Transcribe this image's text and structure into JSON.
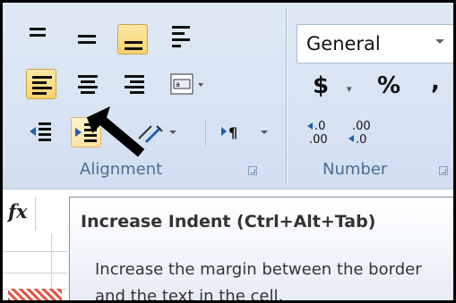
{
  "ribbon": {
    "alignment": {
      "group_label": "Alignment",
      "launcher_icon": "dialog-launcher-icon",
      "buttons": [
        {
          "name": "top-align",
          "icon": "align-top-icon"
        },
        {
          "name": "middle-align",
          "icon": "align-middle-icon"
        },
        {
          "name": "bottom-align",
          "icon": "align-bottom-icon",
          "state": "active"
        },
        {
          "name": "wrap-text",
          "icon": "wrap-text-icon"
        },
        {
          "name": "align-left",
          "icon": "align-text-left-icon",
          "state": "active"
        },
        {
          "name": "center",
          "icon": "align-text-center-icon"
        },
        {
          "name": "align-right",
          "icon": "align-text-right-icon"
        },
        {
          "name": "merge-center",
          "icon": "merge-center-icon"
        },
        {
          "name": "decrease-indent",
          "icon": "decrease-indent-icon"
        },
        {
          "name": "increase-indent",
          "icon": "increase-indent-icon",
          "state": "hover"
        },
        {
          "name": "orientation",
          "icon": "orientation-icon"
        },
        {
          "name": "text-direction",
          "icon": "text-direction-icon"
        }
      ]
    },
    "number": {
      "group_label": "Number",
      "format_value": "General",
      "currency_symbol": "$",
      "percent_symbol": "%",
      "comma_symbol": ",",
      "increase_decimal": ".0\n.00",
      "decrease_decimal": ".00\n.0"
    }
  },
  "formula_bar": {
    "fx_label": "fx"
  },
  "tooltip": {
    "title": "Increase Indent (Ctrl+Alt+Tab)",
    "body": "Increase the margin between the border and the text in the cell."
  },
  "colors": {
    "highlight": "#fbd06b",
    "group_label": "#4a6b93"
  }
}
